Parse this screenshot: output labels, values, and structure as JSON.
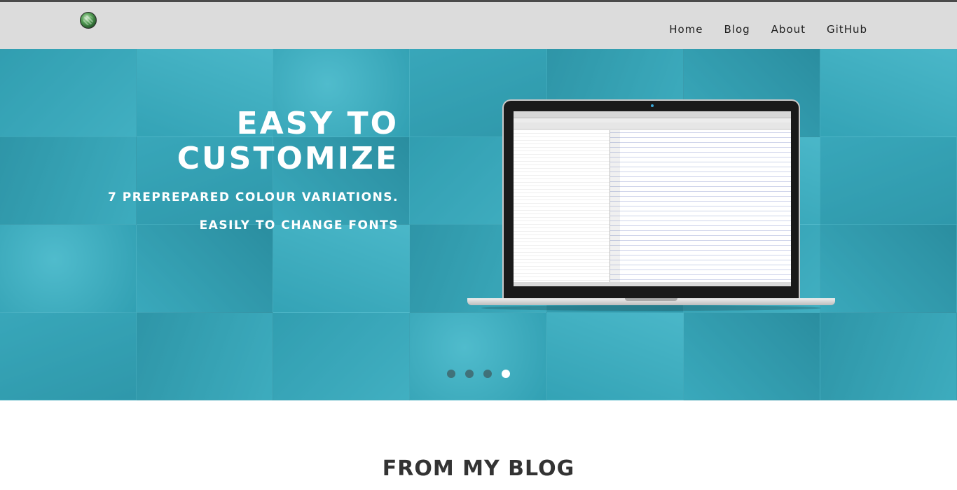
{
  "header": {
    "logo": "site-logo-icon",
    "nav": [
      {
        "label": "Home"
      },
      {
        "label": "Blog"
      },
      {
        "label": "About"
      },
      {
        "label": "GitHub"
      }
    ]
  },
  "hero": {
    "headline_line1": "EASY TO",
    "headline_line2": "CUSTOMIZE",
    "subline1": "7 PREPREPARED COLOUR VARIATIONS.",
    "subline2": "EASILY TO CHANGE FONTS",
    "image": "laptop-code-editor-screenshot",
    "carousel": {
      "slides": 4,
      "active_slide": 4
    },
    "overlay_color": "#38a9bb"
  },
  "blog_section": {
    "title": "FROM MY BLOG"
  }
}
